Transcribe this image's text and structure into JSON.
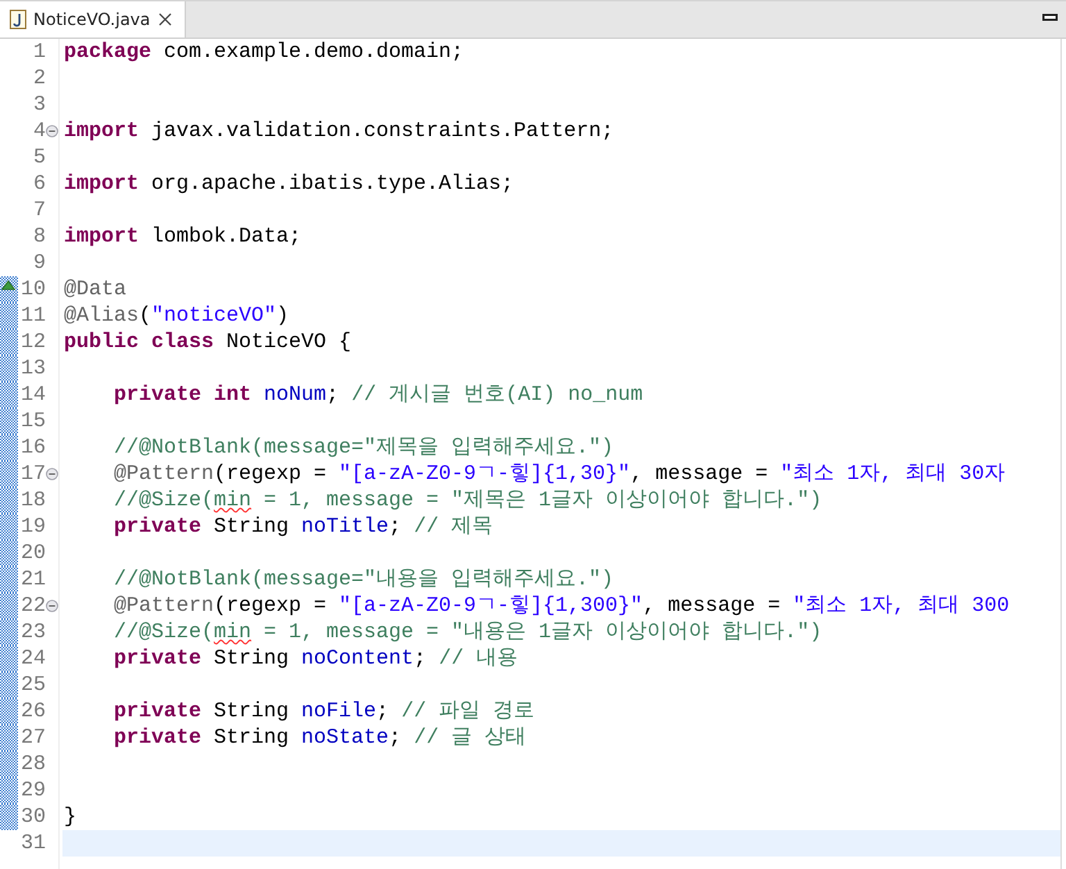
{
  "tab": {
    "label": "NoticeVO.java",
    "selected": true
  },
  "lines": [
    {
      "number": "1",
      "fold": false,
      "changed": false,
      "override": false,
      "current": false,
      "indented": false,
      "tokens": [
        {
          "kind": "keyword",
          "text": "package"
        },
        {
          "kind": "plain",
          "text": " com.example.demo.domain;"
        }
      ]
    },
    {
      "number": "2",
      "fold": false,
      "changed": false,
      "override": false,
      "current": false
    },
    {
      "number": "3",
      "fold": false,
      "changed": false,
      "override": false,
      "current": false
    },
    {
      "number": "4",
      "fold": true,
      "changed": false,
      "override": false,
      "current": false,
      "indented": false,
      "tokens": [
        {
          "kind": "keyword",
          "text": "import"
        },
        {
          "kind": "plain",
          "text": " javax.validation.constraints.Pattern;"
        }
      ]
    },
    {
      "number": "5",
      "fold": false,
      "changed": false,
      "override": false,
      "current": false
    },
    {
      "number": "6",
      "fold": false,
      "changed": false,
      "override": false,
      "current": false,
      "indented": false,
      "tokens": [
        {
          "kind": "keyword",
          "text": "import"
        },
        {
          "kind": "plain",
          "text": " org.apache.ibatis.type.Alias;"
        }
      ]
    },
    {
      "number": "7",
      "fold": false,
      "changed": false,
      "override": false,
      "current": false
    },
    {
      "number": "8",
      "fold": false,
      "changed": false,
      "override": false,
      "current": false,
      "indented": false,
      "tokens": [
        {
          "kind": "keyword",
          "text": "import"
        },
        {
          "kind": "plain",
          "text": " lombok.Data;"
        }
      ]
    },
    {
      "number": "9",
      "fold": false,
      "changed": false,
      "override": false,
      "current": false
    },
    {
      "number": "10",
      "fold": false,
      "changed": true,
      "override": true,
      "current": false,
      "indented": false,
      "tokens": [
        {
          "kind": "annotation",
          "text": "@Data"
        }
      ]
    },
    {
      "number": "11",
      "fold": false,
      "changed": true,
      "override": false,
      "current": false,
      "indented": false,
      "tokens": [
        {
          "kind": "annotation",
          "text": "@Alias"
        },
        {
          "kind": "plain",
          "text": "("
        },
        {
          "kind": "string",
          "text": "\"noticeVO\""
        },
        {
          "kind": "plain",
          "text": ")"
        }
      ]
    },
    {
      "number": "12",
      "fold": false,
      "changed": true,
      "override": false,
      "current": false,
      "indented": false,
      "tokens": [
        {
          "kind": "keyword",
          "text": "public class"
        },
        {
          "kind": "plain",
          "text": " NoticeVO {"
        }
      ]
    },
    {
      "number": "13",
      "fold": false,
      "changed": true,
      "override": false,
      "current": false
    },
    {
      "number": "14",
      "fold": false,
      "changed": true,
      "override": false,
      "current": false,
      "indented": true,
      "tokens": [
        {
          "kind": "keyword",
          "text": "private int"
        },
        {
          "kind": "field",
          "text": " noNum"
        },
        {
          "kind": "plain",
          "text": ";"
        },
        {
          "kind": "comment",
          "text": " // 게시글 번호(AI) no_num"
        }
      ]
    },
    {
      "number": "15",
      "fold": false,
      "changed": true,
      "override": false,
      "current": false
    },
    {
      "number": "16",
      "fold": false,
      "changed": true,
      "override": false,
      "current": false,
      "indented": true,
      "tokens": [
        {
          "kind": "comment",
          "text": "//@NotBlank(message=\"제목을 입력해주세요.\")"
        }
      ]
    },
    {
      "number": "17",
      "fold": true,
      "changed": true,
      "override": false,
      "current": false,
      "indented": true,
      "tokens": [
        {
          "kind": "annotation",
          "text": "@Pattern"
        },
        {
          "kind": "plain",
          "text": "(regexp = "
        },
        {
          "kind": "string",
          "text": "\"[a-zA-Z0-9ㄱ-힣]{1,30}\""
        },
        {
          "kind": "plain",
          "text": ", message = "
        },
        {
          "kind": "string",
          "text": "\"최소 1자, 최대 30자"
        }
      ]
    },
    {
      "number": "18",
      "fold": false,
      "changed": true,
      "override": false,
      "current": false,
      "indented": true,
      "tokens": [
        {
          "kind": "comment",
          "text": "//@Size("
        },
        {
          "kind": "misspelled",
          "text": "min"
        },
        {
          "kind": "comment",
          "text": " = 1, message = \"제목은 1글자 이상이어야 합니다.\")"
        }
      ]
    },
    {
      "number": "19",
      "fold": false,
      "changed": true,
      "override": false,
      "current": false,
      "indented": true,
      "tokens": [
        {
          "kind": "keyword",
          "text": "private"
        },
        {
          "kind": "plain",
          "text": " String"
        },
        {
          "kind": "field",
          "text": " noTitle"
        },
        {
          "kind": "plain",
          "text": ";"
        },
        {
          "kind": "comment",
          "text": " // 제목"
        }
      ]
    },
    {
      "number": "20",
      "fold": false,
      "changed": true,
      "override": false,
      "current": false
    },
    {
      "number": "21",
      "fold": false,
      "changed": true,
      "override": false,
      "current": false,
      "indented": true,
      "tokens": [
        {
          "kind": "comment",
          "text": "//@NotBlank(message=\"내용을 입력해주세요.\")"
        }
      ]
    },
    {
      "number": "22",
      "fold": true,
      "changed": true,
      "override": false,
      "current": false,
      "indented": true,
      "tokens": [
        {
          "kind": "annotation",
          "text": "@Pattern"
        },
        {
          "kind": "plain",
          "text": "(regexp = "
        },
        {
          "kind": "string",
          "text": "\"[a-zA-Z0-9ㄱ-힣]{1,300}\""
        },
        {
          "kind": "plain",
          "text": ", message = "
        },
        {
          "kind": "string",
          "text": "\"최소 1자, 최대 300"
        }
      ]
    },
    {
      "number": "23",
      "fold": false,
      "changed": true,
      "override": false,
      "current": false,
      "indented": true,
      "tokens": [
        {
          "kind": "comment",
          "text": "//@Size("
        },
        {
          "kind": "misspelled",
          "text": "min"
        },
        {
          "kind": "comment",
          "text": " = 1, message = \"내용은 1글자 이상이어야 합니다.\")"
        }
      ]
    },
    {
      "number": "24",
      "fold": false,
      "changed": true,
      "override": false,
      "current": false,
      "indented": true,
      "tokens": [
        {
          "kind": "keyword",
          "text": "private"
        },
        {
          "kind": "plain",
          "text": " String"
        },
        {
          "kind": "field",
          "text": " noContent"
        },
        {
          "kind": "plain",
          "text": ";"
        },
        {
          "kind": "comment",
          "text": " // 내용"
        }
      ]
    },
    {
      "number": "25",
      "fold": false,
      "changed": true,
      "override": false,
      "current": false
    },
    {
      "number": "26",
      "fold": false,
      "changed": true,
      "override": false,
      "current": false,
      "indented": true,
      "tokens": [
        {
          "kind": "keyword",
          "text": "private"
        },
        {
          "kind": "plain",
          "text": " String"
        },
        {
          "kind": "field",
          "text": " noFile"
        },
        {
          "kind": "plain",
          "text": ";"
        },
        {
          "kind": "comment",
          "text": " // 파일 경로"
        }
      ]
    },
    {
      "number": "27",
      "fold": false,
      "changed": true,
      "override": false,
      "current": false,
      "indented": true,
      "tokens": [
        {
          "kind": "keyword",
          "text": "private"
        },
        {
          "kind": "plain",
          "text": " String"
        },
        {
          "kind": "field",
          "text": " noState"
        },
        {
          "kind": "plain",
          "text": ";"
        },
        {
          "kind": "comment",
          "text": " // 글 상태"
        }
      ]
    },
    {
      "number": "28",
      "fold": false,
      "changed": true,
      "override": false,
      "current": false
    },
    {
      "number": "29",
      "fold": false,
      "changed": true,
      "override": false,
      "current": false
    },
    {
      "number": "30",
      "fold": false,
      "changed": true,
      "override": false,
      "current": false,
      "indented": false,
      "tokens": [
        {
          "kind": "plain",
          "text": "}"
        }
      ]
    },
    {
      "number": "31",
      "fold": false,
      "changed": false,
      "override": false,
      "current": true
    }
  ]
}
